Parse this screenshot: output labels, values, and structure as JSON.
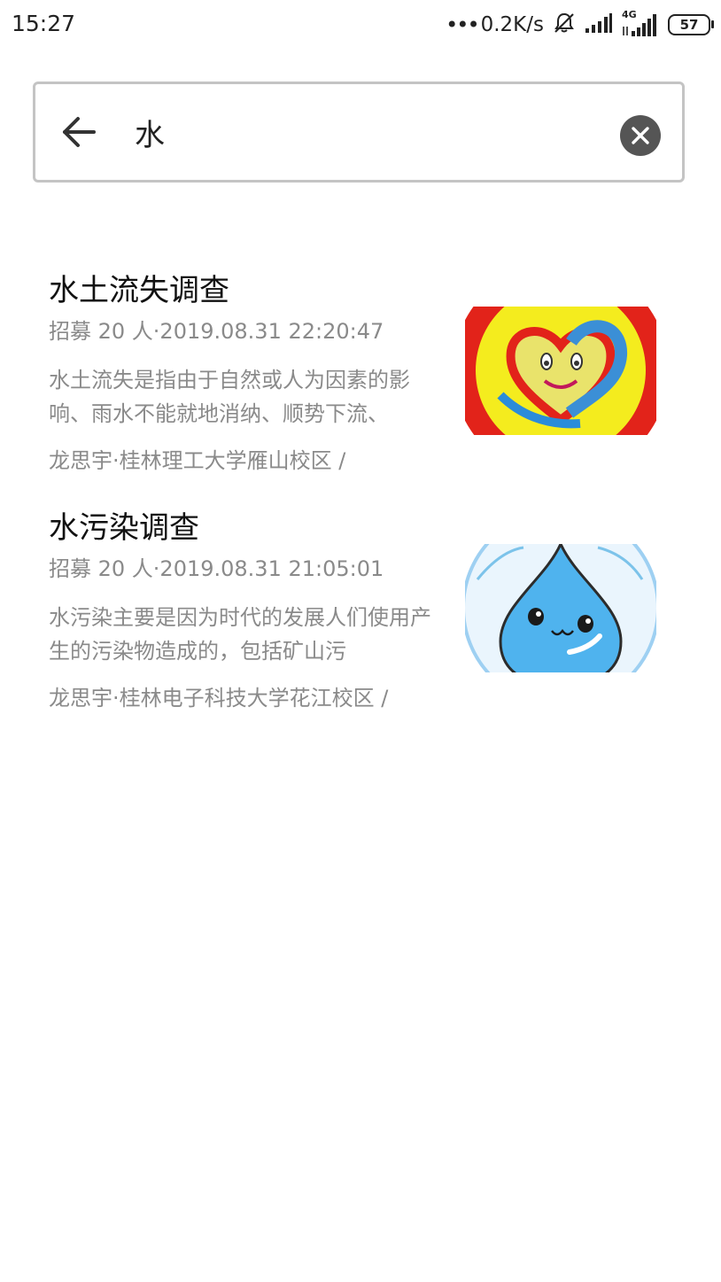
{
  "status_bar": {
    "time": "15:27",
    "net_speed": "0.2K/s",
    "network_type": "4G",
    "battery": "57",
    "icons": [
      "more-dots-icon",
      "mute-icon",
      "signal-icon",
      "signal-4g-icon",
      "battery-icon"
    ]
  },
  "search": {
    "query": "水",
    "back_icon": "arrow-left-icon",
    "clear_icon": "clear-circle-icon"
  },
  "results": [
    {
      "title": "水土流失调查",
      "meta": "招募 20 人·2019.08.31 22:20:47",
      "description": "水土流失是指由于自然或人为因素的影响、雨水不能就地消纳、顺势下流、",
      "footer": "龙思宇·桂林理工大学雁山校区 /",
      "thumb_icon": "heart-logo-thumbnail"
    },
    {
      "title": "水污染调查",
      "meta": "招募 20 人·2019.08.31 21:05:01",
      "description": "水污染主要是因为时代的发展人们使用产生的污染物造成的，包括矿山污",
      "footer": "龙思宇·桂林电子科技大学花江校区 /",
      "thumb_icon": "water-drop-thumbnail"
    }
  ],
  "colors": {
    "text_primary": "#111111",
    "text_secondary": "#8a8a8a",
    "search_border": "#c4c4c4",
    "clear_button": "#555555"
  }
}
